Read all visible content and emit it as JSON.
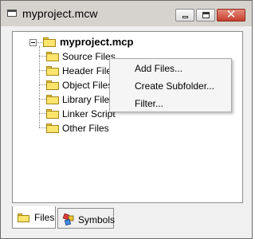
{
  "window": {
    "title": "myproject.mcw",
    "close_glyph": "✕"
  },
  "tree": {
    "root": {
      "label": "myproject.mcp",
      "icon": "folder-icon",
      "expanded": true
    },
    "children": [
      {
        "label": "Source Files",
        "icon": "folder-icon"
      },
      {
        "label": "Header Files",
        "icon": "folder-icon"
      },
      {
        "label": "Object Files",
        "icon": "folder-icon"
      },
      {
        "label": "Library Files",
        "icon": "folder-icon"
      },
      {
        "label": "Linker Script",
        "icon": "folder-icon"
      },
      {
        "label": "Other Files",
        "icon": "folder-icon"
      }
    ]
  },
  "context_menu": {
    "items": [
      {
        "label": "Add Files..."
      },
      {
        "label": "Create Subfolder..."
      },
      {
        "label": "Filter..."
      }
    ]
  },
  "tabs": [
    {
      "label": "Files",
      "icon": "folder-icon",
      "active": true
    },
    {
      "label": "Symbols",
      "icon": "symbols-icon",
      "active": false
    }
  ],
  "colors": {
    "folder_fill": "#fde56d",
    "close_button": "#c4402e",
    "titlebar": "#d6d3cf"
  }
}
